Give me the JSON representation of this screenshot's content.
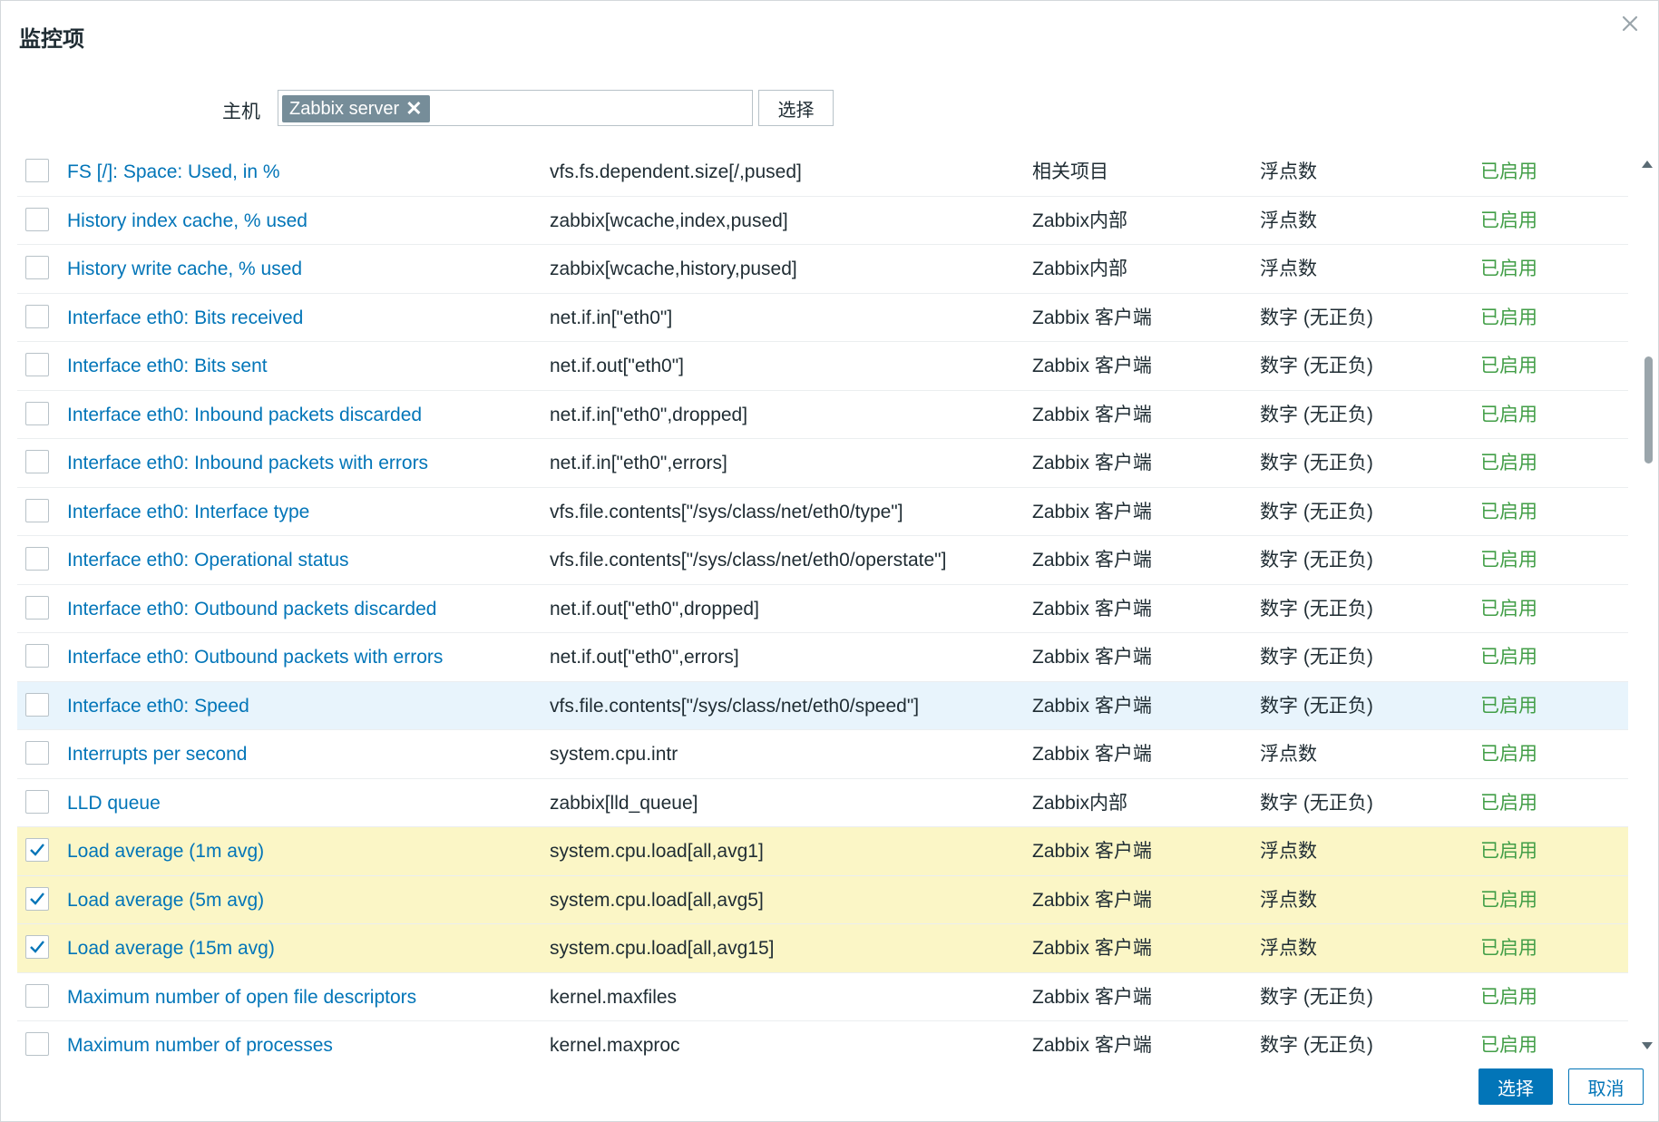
{
  "dialog": {
    "title": "监控项",
    "close_icon": "close-icon"
  },
  "host": {
    "label": "主机",
    "chip": "Zabbix server",
    "select_label": "选择"
  },
  "items": [
    {
      "name": "FS [/]: Space: Used, in %",
      "key": "vfs.fs.dependent.size[/,pused]",
      "type": "相关项目",
      "value_type": "浮点数",
      "status": "已启用",
      "checked": false,
      "hover": false
    },
    {
      "name": "History index cache, % used",
      "key": "zabbix[wcache,index,pused]",
      "type": "Zabbix内部",
      "value_type": "浮点数",
      "status": "已启用",
      "checked": false,
      "hover": false
    },
    {
      "name": "History write cache, % used",
      "key": "zabbix[wcache,history,pused]",
      "type": "Zabbix内部",
      "value_type": "浮点数",
      "status": "已启用",
      "checked": false,
      "hover": false
    },
    {
      "name": "Interface eth0: Bits received",
      "key": "net.if.in[\"eth0\"]",
      "type": "Zabbix 客户端",
      "value_type": "数字 (无正负)",
      "status": "已启用",
      "checked": false,
      "hover": false
    },
    {
      "name": "Interface eth0: Bits sent",
      "key": "net.if.out[\"eth0\"]",
      "type": "Zabbix 客户端",
      "value_type": "数字 (无正负)",
      "status": "已启用",
      "checked": false,
      "hover": false
    },
    {
      "name": "Interface eth0: Inbound packets discarded",
      "key": "net.if.in[\"eth0\",dropped]",
      "type": "Zabbix 客户端",
      "value_type": "数字 (无正负)",
      "status": "已启用",
      "checked": false,
      "hover": false
    },
    {
      "name": "Interface eth0: Inbound packets with errors",
      "key": "net.if.in[\"eth0\",errors]",
      "type": "Zabbix 客户端",
      "value_type": "数字 (无正负)",
      "status": "已启用",
      "checked": false,
      "hover": false
    },
    {
      "name": "Interface eth0: Interface type",
      "key": "vfs.file.contents[\"/sys/class/net/eth0/type\"]",
      "type": "Zabbix 客户端",
      "value_type": "数字 (无正负)",
      "status": "已启用",
      "checked": false,
      "hover": false
    },
    {
      "name": "Interface eth0: Operational status",
      "key": "vfs.file.contents[\"/sys/class/net/eth0/operstate\"]",
      "type": "Zabbix 客户端",
      "value_type": "数字 (无正负)",
      "status": "已启用",
      "checked": false,
      "hover": false
    },
    {
      "name": "Interface eth0: Outbound packets discarded",
      "key": "net.if.out[\"eth0\",dropped]",
      "type": "Zabbix 客户端",
      "value_type": "数字 (无正负)",
      "status": "已启用",
      "checked": false,
      "hover": false
    },
    {
      "name": "Interface eth0: Outbound packets with errors",
      "key": "net.if.out[\"eth0\",errors]",
      "type": "Zabbix 客户端",
      "value_type": "数字 (无正负)",
      "status": "已启用",
      "checked": false,
      "hover": false
    },
    {
      "name": "Interface eth0: Speed",
      "key": "vfs.file.contents[\"/sys/class/net/eth0/speed\"]",
      "type": "Zabbix 客户端",
      "value_type": "数字 (无正负)",
      "status": "已启用",
      "checked": false,
      "hover": true
    },
    {
      "name": "Interrupts per second",
      "key": "system.cpu.intr",
      "type": "Zabbix 客户端",
      "value_type": "浮点数",
      "status": "已启用",
      "checked": false,
      "hover": false
    },
    {
      "name": "LLD queue",
      "key": "zabbix[lld_queue]",
      "type": "Zabbix内部",
      "value_type": "数字 (无正负)",
      "status": "已启用",
      "checked": false,
      "hover": false
    },
    {
      "name": "Load average (1m avg)",
      "key": "system.cpu.load[all,avg1]",
      "type": "Zabbix 客户端",
      "value_type": "浮点数",
      "status": "已启用",
      "checked": true,
      "hover": false
    },
    {
      "name": "Load average (5m avg)",
      "key": "system.cpu.load[all,avg5]",
      "type": "Zabbix 客户端",
      "value_type": "浮点数",
      "status": "已启用",
      "checked": true,
      "hover": false
    },
    {
      "name": "Load average (15m avg)",
      "key": "system.cpu.load[all,avg15]",
      "type": "Zabbix 客户端",
      "value_type": "浮点数",
      "status": "已启用",
      "checked": true,
      "hover": false
    },
    {
      "name": "Maximum number of open file descriptors",
      "key": "kernel.maxfiles",
      "type": "Zabbix 客户端",
      "value_type": "数字 (无正负)",
      "status": "已启用",
      "checked": false,
      "hover": false
    },
    {
      "name": "Maximum number of processes",
      "key": "kernel.maxproc",
      "type": "Zabbix 客户端",
      "value_type": "数字 (无正负)",
      "status": "已启用",
      "checked": false,
      "hover": false
    }
  ],
  "footer": {
    "select_label": "选择",
    "cancel_label": "取消"
  },
  "colors": {
    "link": "#0275b8",
    "status_enabled": "#429e47",
    "row_checked": "#fbf6c6",
    "row_hover": "#e8f4fc",
    "primary_button": "#0275b8"
  }
}
